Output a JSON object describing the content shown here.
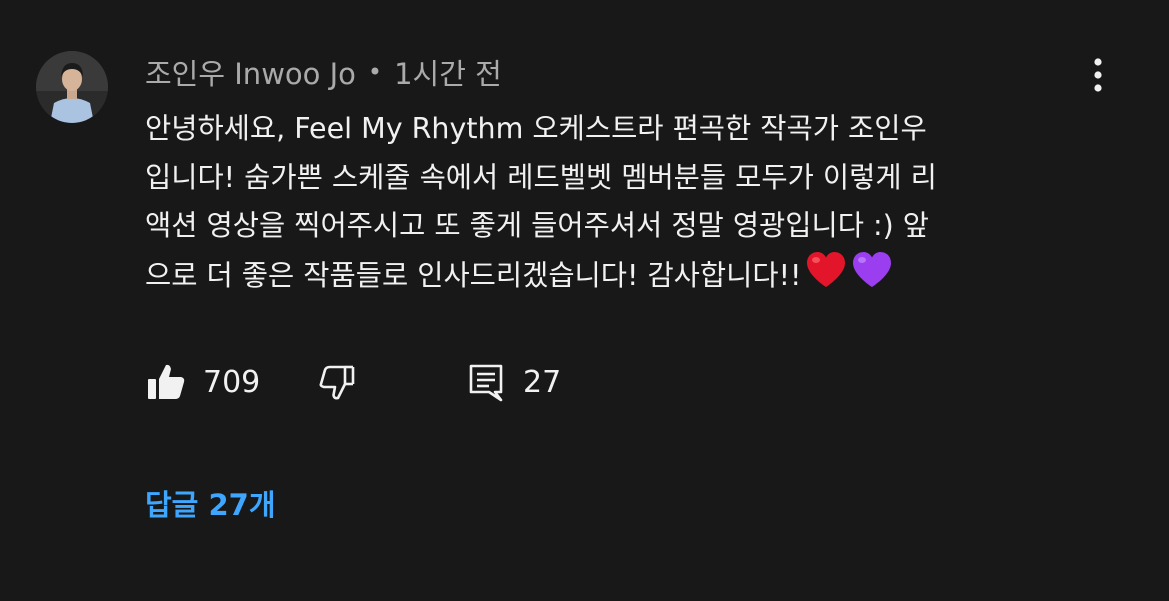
{
  "comment": {
    "author": "조인우 Inwoo Jo",
    "separator": "•",
    "timestamp": "1시간 전",
    "text_lines": [
      "안녕하세요, Feel My Rhythm 오케스트라 편곡한 작곡가 조인우",
      "입니다! 숨가쁜 스케줄 속에서 레드벨벳 멤버분들 모두가 이렇게 리",
      "액션 영상을 찍어주시고 또 좋게 들어주셔서 정말 영광입니다 :) 앞",
      "으로 더 좋은 작품들로 인사드리겠습니다! 감사합니다!!"
    ],
    "emojis": [
      "red-heart",
      "purple-heart"
    ],
    "like_count": "709",
    "reply_count": "27",
    "replies_link": "답글 27개"
  },
  "colors": {
    "background": "#181818",
    "text": "#f1f1f1",
    "meta": "#aaaaaa",
    "link": "#3ea6ff",
    "red_heart": "#e2152b",
    "purple_heart": "#9b3ef0"
  },
  "icons": {
    "avatar": "profile-photo",
    "more": "more-vert-icon",
    "like": "thumbs-up-filled-icon",
    "dislike": "thumbs-down-outline-icon",
    "reply": "comment-icon"
  }
}
